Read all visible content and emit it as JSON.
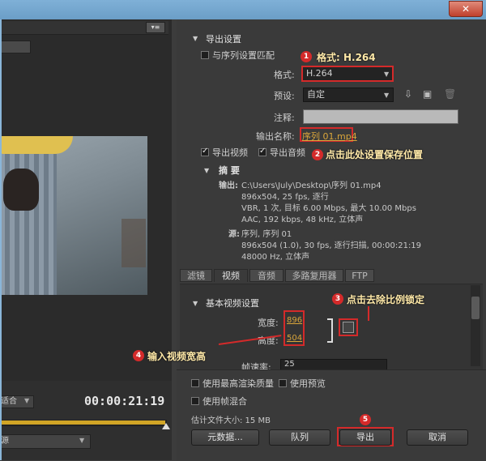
{
  "window": {
    "close_glyph": "✕"
  },
  "left_panel": {
    "menu_glyph": "▾≡",
    "zoom_value": "适合",
    "timecode": "00:00:21:19",
    "source_value": "源"
  },
  "export_settings": {
    "section_title": "导出设置",
    "match_sequence_label": "与序列设置匹配",
    "format_label": "格式:",
    "format_value": "H.264",
    "preset_label": "预设:",
    "preset_value": "自定",
    "comments_label": "注释:",
    "comments_value": "",
    "output_name_label": "输出名称:",
    "output_name_value": "序列 01.mp4",
    "export_video_label": "导出视频",
    "export_audio_label": "导出音频"
  },
  "summary": {
    "title": "摘 要",
    "output_label": "输出:",
    "output_lines": [
      "C:\\Users\\July\\Desktop\\序列 01.mp4",
      "896x504, 25 fps, 逐行",
      "VBR, 1 次, 目标 6.00 Mbps, 最大 10.00 Mbps",
      "AAC, 192 kbps, 48 kHz, 立体声"
    ],
    "source_label": "源:",
    "source_lines": [
      "序列, 序列 01",
      "896x504 (1.0), 30 fps, 逐行扫描, 00:00:21:19",
      "48000 Hz, 立体声"
    ]
  },
  "tabs": [
    "滤镜",
    "视频",
    "音频",
    "多路复用器",
    "FTP"
  ],
  "video_settings": {
    "section_title": "基本视频设置",
    "width_label": "宽度:",
    "width_value": "896",
    "height_label": "高度:",
    "height_value": "504",
    "framerate_label": "帧速率:",
    "framerate_value": "25"
  },
  "bottom_options": {
    "max_render_label": "使用最高渲染质量",
    "use_preview_label": "使用预览",
    "frame_blend_label": "使用帧混合",
    "file_size_label": "估计文件大小: 15 MB"
  },
  "buttons": {
    "metadata": "元数据...",
    "queue": "队列",
    "export": "导出",
    "cancel": "取消"
  },
  "annotations": {
    "a1": {
      "num": "1",
      "text": "格式: H.264"
    },
    "a2": {
      "num": "2",
      "text": "点击此处设置保存位置"
    },
    "a3": {
      "num": "3",
      "text": "点击去除比例锁定"
    },
    "a4": {
      "num": "4",
      "text": "输入视频宽高"
    },
    "a5": {
      "num": "5"
    }
  },
  "colors": {
    "accent_red": "#d42a2a",
    "timeline_gold": "#d1a526",
    "value_gold": "#d9a53a"
  }
}
